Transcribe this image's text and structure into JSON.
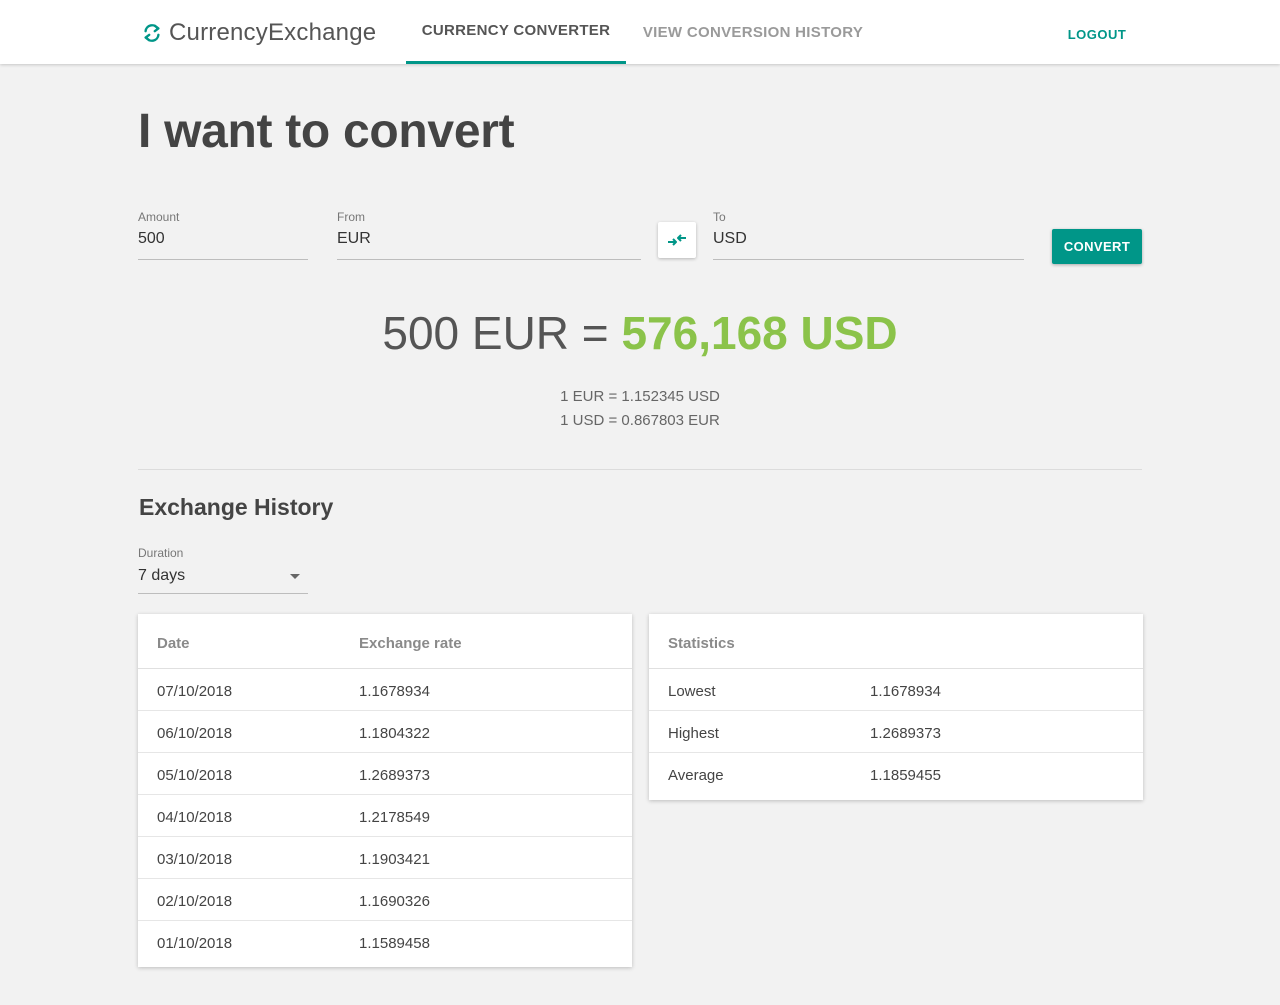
{
  "header": {
    "logo_part1": "Currency",
    "logo_part2": "Exchange",
    "tabs": [
      {
        "label": "CURRENCY CONVERTER",
        "active": true
      },
      {
        "label": "VIEW CONVERSION HISTORY",
        "active": false
      }
    ],
    "logout_label": "LOGOUT"
  },
  "headline": "I want to convert",
  "form": {
    "amount_label": "Amount",
    "amount_value": "500",
    "from_label": "From",
    "from_value": "EUR",
    "to_label": "To",
    "to_value": "USD",
    "convert_label": "CONVERT",
    "swap_icon": "swap-arrows-icon"
  },
  "result": {
    "input_text": "500 EUR",
    "equals": "=",
    "output_text": "576,168 USD",
    "rate1": "1 EUR = 1.152345 USD",
    "rate2": "1 USD = 0.867803 EUR"
  },
  "history": {
    "title": "Exchange History",
    "duration_label": "Duration",
    "duration_value": "7 days",
    "rates_table": {
      "col_date": "Date",
      "col_rate": "Exchange rate",
      "rows": [
        {
          "date": "07/10/2018",
          "rate": "1.1678934"
        },
        {
          "date": "06/10/2018",
          "rate": "1.1804322"
        },
        {
          "date": "05/10/2018",
          "rate": "1.2689373"
        },
        {
          "date": "04/10/2018",
          "rate": "1.2178549"
        },
        {
          "date": "03/10/2018",
          "rate": "1.1903421"
        },
        {
          "date": "02/10/2018",
          "rate": "1.1690326"
        },
        {
          "date": "01/10/2018",
          "rate": "1.1589458"
        }
      ]
    },
    "stats_table": {
      "title": "Statistics",
      "rows": [
        {
          "label": "Lowest",
          "value": "1.1678934"
        },
        {
          "label": "Highest",
          "value": "1.2689373"
        },
        {
          "label": "Average",
          "value": "1.1859455"
        }
      ]
    }
  },
  "colors": {
    "accent": "#009688",
    "result_green": "#8bc34a",
    "background": "#f2f2f2"
  }
}
